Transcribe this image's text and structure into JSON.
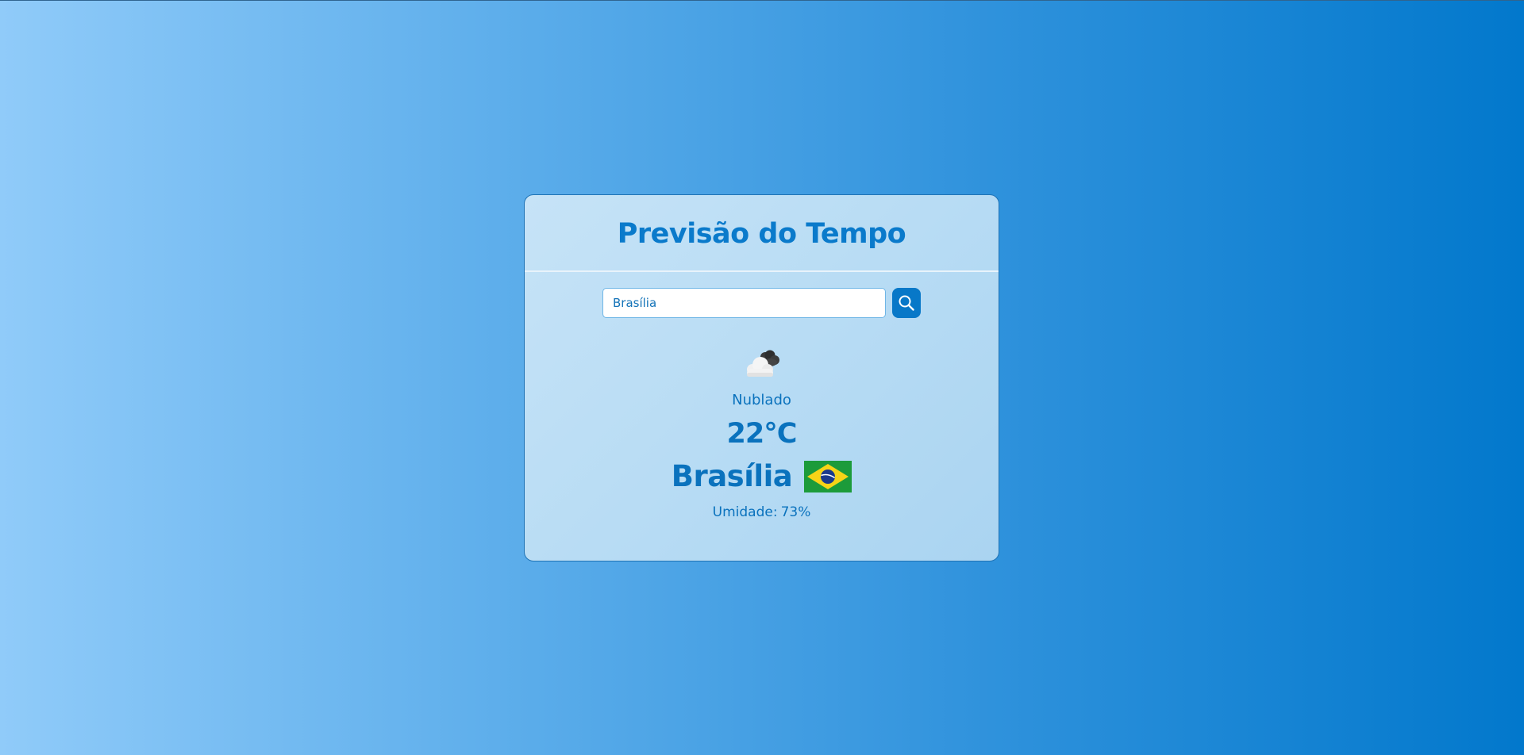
{
  "app": {
    "title": "Previsão do Tempo"
  },
  "search": {
    "value": "Brasília",
    "button_icon": "search-icon"
  },
  "weather": {
    "icon": "cloudy-icon",
    "description": "Nublado",
    "temperature": "22°C",
    "city": "Brasília",
    "country_flag_icon": "brazil-flag-icon",
    "humidity_label": "Umidade:",
    "humidity_value": "73%"
  },
  "colors": {
    "accent": "#0878c8",
    "text": "#0a72bd",
    "background_start": "#90cbf9",
    "background_end": "#0278cc"
  }
}
